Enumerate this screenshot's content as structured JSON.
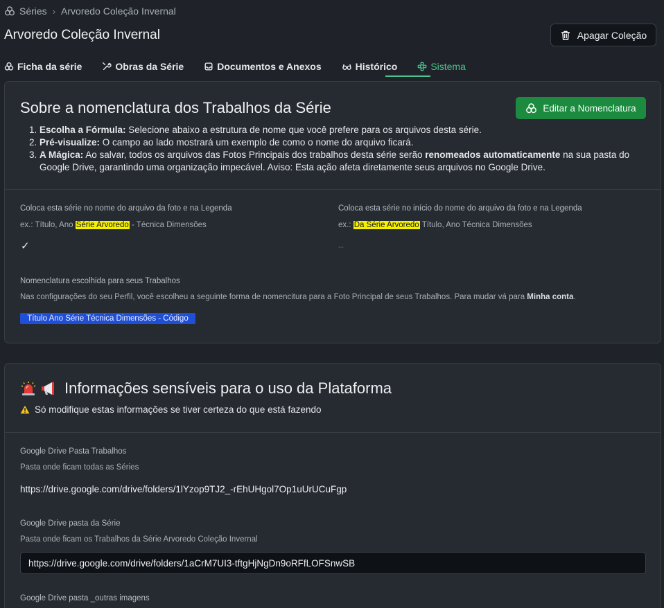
{
  "breadcrumb": {
    "root": "Séries",
    "separator": "›",
    "current": "Arvoredo Coleção Invernal"
  },
  "header": {
    "title": "Arvoredo Coleção Invernal",
    "delete_label": "Apagar Coleção"
  },
  "tabs": [
    {
      "label": "Ficha da série",
      "icon": "circles-icon"
    },
    {
      "label": "Obras da Série",
      "icon": "tools-icon"
    },
    {
      "label": "Documentos e Anexos",
      "icon": "document-icon"
    },
    {
      "label": "Histórico",
      "icon": "glasses-icon"
    },
    {
      "label": "Sistema",
      "icon": "sistema-icon",
      "active": true
    }
  ],
  "nomenclature": {
    "title": "Sobre a nomenclatura dos Trabalhos da Série",
    "edit_label": "Editar a Nomenclatura",
    "steps": [
      {
        "bold": "Escolha a Fórmula:",
        "text": " Selecione abaixo a estrutura de nome que você prefere para os arquivos desta série."
      },
      {
        "bold": "Pré-visualize:",
        "text": " O campo ao lado mostrará um exemplo de como o nome do arquivo ficará."
      },
      {
        "bold": "A Mágica:",
        "text": " Ao salvar, todos os arquivos das Fotos Principais dos trabalhos desta série serão ",
        "bold2": "renomeados automaticamente",
        "text2": " na sua pasta do Google Drive, garantindo uma organização impecável. Aviso: Esta ação afeta diretamente seus arquivos no Google Drive."
      }
    ],
    "option_a": {
      "label": "Coloca esta série no nome do arquivo da foto e na Legenda",
      "example_prefix": "ex.: Título, Ano ",
      "example_highlight": "Série Arvoredo",
      "example_suffix": " - Técnica Dimensões",
      "value": "✓"
    },
    "option_b": {
      "label": "Coloca esta série no início do nome do arquivo da foto e na Legenda",
      "example_prefix": "ex.: ",
      "example_highlight": "Da Série Arvoredo",
      "example_suffix": " Título, Ano Técnica Dimensões",
      "value": "--"
    },
    "chosen": {
      "label": "Nomenclatura escolhida para seus Trabalhos",
      "text_prefix": "Nas configurações do seu Perfil, você escolheu a seguinte forma de nomencitura para a Foto Principal de seus Trabalhos. Para mudar vá para ",
      "text_link": "Minha conta",
      "text_suffix": ".",
      "chip": "Título Ano Série Técnica Dimensões - Código"
    }
  },
  "sensitive": {
    "title": "Informações sensíveis para o uso da Plataforma",
    "warning": "Só modifique estas informações se tiver certeza do que está fazendo",
    "fields": [
      {
        "label": "Google Drive Pasta Trabalhos",
        "help": "Pasta onde ficam todas as Séries",
        "value": "https://drive.google.com/drive/folders/1lYzop9TJ2_-rEhUHgol7Op1uUrUCuFgp"
      },
      {
        "label": "Google Drive pasta da Série",
        "help": "Pasta onde ficam os Trabalhos da Série Arvoredo Coleção Invernal",
        "value": "https://drive.google.com/drive/folders/1aCrM7UI3-tftgHjNgDn9oRFfLOFSnwSB"
      },
      {
        "label": "Google Drive pasta _outras imagens"
      }
    ]
  },
  "colors": {
    "accent": "#4ec28c",
    "primary_button": "#1c8a3f",
    "chip": "#1f4fd6",
    "highlight": "#f5f100"
  }
}
